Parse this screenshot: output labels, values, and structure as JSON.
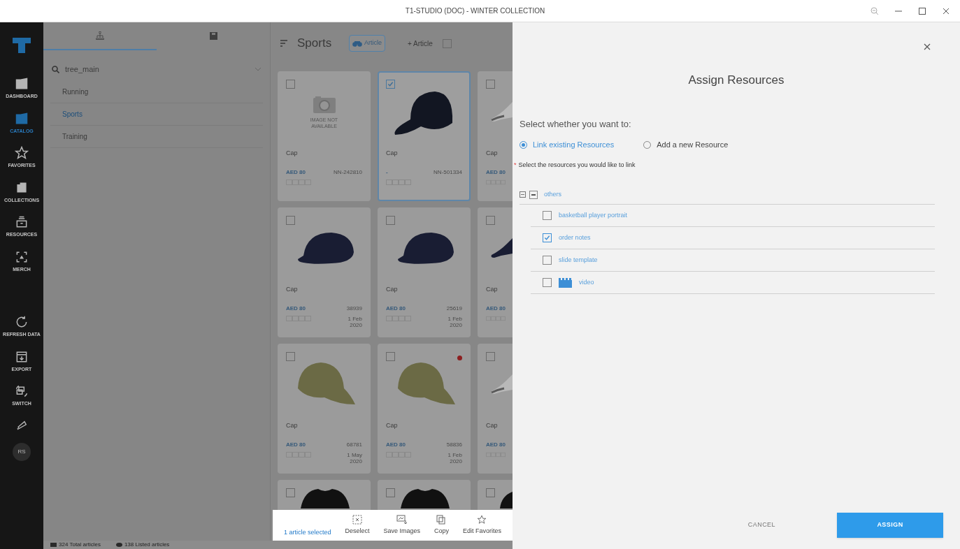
{
  "window": {
    "title": "T1-STUDIO (DOC) - WINTER COLLECTION"
  },
  "nav": {
    "items": [
      {
        "label": "DASHBOARD",
        "selected": false
      },
      {
        "label": "CATALOG",
        "selected": true
      },
      {
        "label": "FAVORITES",
        "selected": false
      },
      {
        "label": "COLLECTIONS",
        "selected": false
      },
      {
        "label": "RESOURCES",
        "selected": false
      },
      {
        "label": "MERCH",
        "selected": false
      }
    ],
    "bottom_items": [
      {
        "label": "REFRESH DATA"
      },
      {
        "label": "EXPORT"
      },
      {
        "label": "SWITCH"
      }
    ],
    "avatar": "RS"
  },
  "tree_panel": {
    "tabs": [
      {
        "selected": true
      },
      {
        "selected": false
      }
    ],
    "search": {
      "value": "tree_main"
    },
    "items": [
      {
        "label": "Running",
        "selected": false
      },
      {
        "label": "Sports",
        "selected": true
      },
      {
        "label": "Training",
        "selected": false
      }
    ]
  },
  "grid": {
    "title": "Sports",
    "view_toggle": {
      "label": "Article",
      "selected": true
    },
    "add_button": "+ Article",
    "select_all": {
      "checked": false
    },
    "cards": [
      {
        "kind": "placeholder",
        "image_text": "IMAGE NOT AVAILABLE",
        "name": "Cap",
        "price": "AED 80",
        "code": "NN-242810",
        "checked": false,
        "flag": false
      },
      {
        "kind": "black-cap",
        "name": "Cap",
        "price": "-",
        "code": "NN-501334",
        "checked": true,
        "flag": false
      },
      {
        "kind": "white-cap",
        "name": "Cap",
        "price": "AED 80",
        "checked": false,
        "flag": false
      },
      {
        "kind": "flat-cap",
        "name": "Cap",
        "price": "AED 80",
        "code": "38939",
        "date": "1 Feb 2020",
        "checked": false,
        "flag": false
      },
      {
        "kind": "flat-cap",
        "name": "Cap",
        "price": "AED 80",
        "code": "25619",
        "date": "1 Feb 2020",
        "checked": false,
        "flag": false
      },
      {
        "kind": "flat-cap",
        "name": "Cap",
        "price": "AED 80",
        "checked": false,
        "flag": false
      },
      {
        "kind": "olive-cap",
        "name": "Cap",
        "price": "AED 80",
        "code": "68781",
        "date": "1 May 2020",
        "checked": false,
        "flag": false
      },
      {
        "kind": "olive-cap",
        "name": "Cap",
        "price": "AED 80",
        "code": "58836",
        "date": "1 Feb 2020",
        "checked": false,
        "flag": true
      },
      {
        "kind": "white-cap",
        "name": "Cap",
        "price": "AED 80",
        "checked": false,
        "flag": false
      },
      {
        "kind": "tshirt",
        "checked": false,
        "flag": false
      },
      {
        "kind": "tshirt",
        "checked": false,
        "flag": false
      },
      {
        "kind": "tshirt",
        "checked": false,
        "flag": false
      }
    ]
  },
  "selection_bar": {
    "count": "1 article selected",
    "actions": [
      "Deselect",
      "Save Images",
      "Copy",
      "Edit Favorites"
    ]
  },
  "status_bar": {
    "total": "324 Total articles",
    "listed": "138 Listed articles"
  },
  "modal": {
    "title": "Assign Resources",
    "prompt": "Select whether you want to:",
    "options": [
      {
        "label": "Link existing Resources",
        "selected": true
      },
      {
        "label": "Add a new Resource",
        "selected": false
      }
    ],
    "required_marker": "*",
    "required_label": "Select the resources you would like to link",
    "tree": {
      "label": "others",
      "expanded": true,
      "indeterminate": true,
      "children": [
        {
          "label": "basketball player portrait",
          "checked": false,
          "kind": "file"
        },
        {
          "label": "order notes",
          "checked": true,
          "kind": "file"
        },
        {
          "label": "slide template",
          "checked": false,
          "kind": "file"
        },
        {
          "label": "video",
          "checked": false,
          "kind": "video"
        }
      ]
    },
    "cancel": "CANCEL",
    "assign": "ASSIGN"
  }
}
